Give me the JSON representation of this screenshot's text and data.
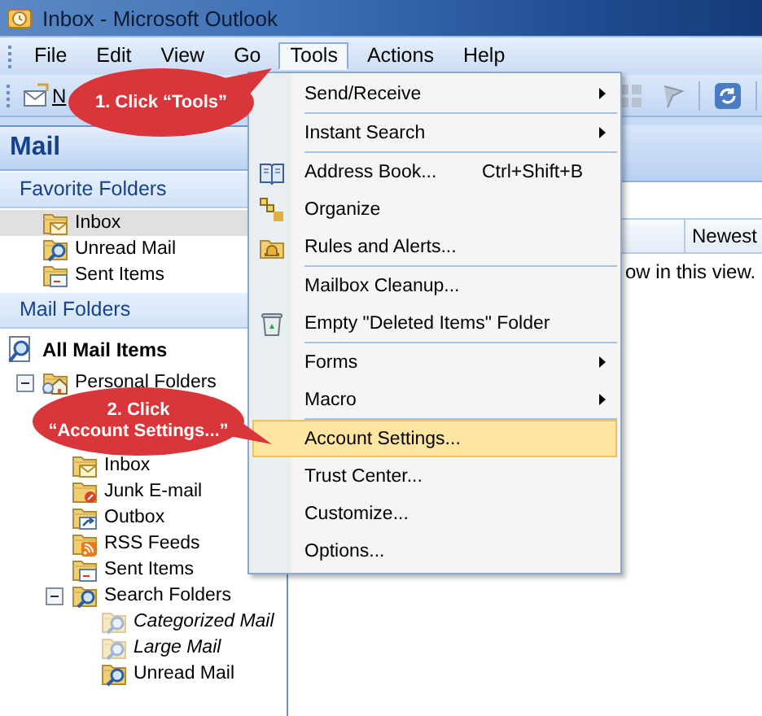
{
  "window": {
    "title": "Inbox - Microsoft Outlook"
  },
  "menu_bar": [
    {
      "label": "File",
      "selected": false
    },
    {
      "label": "Edit",
      "selected": false
    },
    {
      "label": "View",
      "selected": false
    },
    {
      "label": "Go",
      "selected": false
    },
    {
      "label": "Tools",
      "selected": true
    },
    {
      "label": "Actions",
      "selected": false
    },
    {
      "label": "Help",
      "selected": false
    }
  ],
  "toolbar": {
    "new_button": "N"
  },
  "navigation": {
    "title": "Mail",
    "favorites": {
      "title": "Favorite Folders",
      "items": [
        {
          "label": "Inbox",
          "kind": "inbox",
          "selected": true
        },
        {
          "label": "Unread Mail",
          "kind": "search",
          "selected": false
        },
        {
          "label": "Sent Items",
          "kind": "sent",
          "selected": false
        }
      ]
    },
    "mail_folders": {
      "title": "Mail Folders",
      "all_items": "All Mail Items",
      "tree": [
        {
          "label": "Personal Folders",
          "kind": "personal",
          "selected": false,
          "expanded": true,
          "children": [
            {
              "label": "Inbox",
              "kind": "inbox",
              "selected": false
            },
            {
              "label": "Junk E-mail",
              "kind": "junk",
              "selected": false
            },
            {
              "label": "Outbox",
              "kind": "outbox",
              "selected": false
            },
            {
              "label": "RSS Feeds",
              "kind": "rss",
              "selected": false
            },
            {
              "label": "Sent Items",
              "kind": "sent",
              "selected": false
            },
            {
              "label": "Search Folders",
              "kind": "search",
              "selected": false,
              "expanded": true,
              "children": [
                {
                  "label": "Categorized Mail",
                  "kind": "search",
                  "selected": false,
                  "dimmed": true
                },
                {
                  "label": "Large Mail",
                  "kind": "search",
                  "selected": false,
                  "dimmed": true
                },
                {
                  "label": "Unread Mail",
                  "kind": "search",
                  "selected": false,
                  "dimmed": false
                }
              ]
            }
          ]
        }
      ]
    }
  },
  "content": {
    "column_header": "Newest",
    "empty_message": "ow in this view."
  },
  "tools_menu": {
    "sections": [
      [
        {
          "label": "Send/Receive",
          "kind": "plain",
          "submenu": true,
          "selected": false
        }
      ],
      [
        {
          "label": "Instant Search",
          "kind": "plain",
          "submenu": true,
          "selected": false
        }
      ],
      [
        {
          "label": "Address Book...",
          "shortcut": "Ctrl+Shift+B",
          "kind": "book",
          "submenu": false,
          "selected": false
        },
        {
          "label": "Organize",
          "kind": "organize",
          "submenu": false,
          "selected": false
        },
        {
          "label": "Rules and Alerts...",
          "kind": "rules",
          "submenu": false,
          "selected": false
        }
      ],
      [
        {
          "label": "Mailbox Cleanup...",
          "kind": "plain",
          "submenu": false,
          "selected": false
        },
        {
          "label": "Empty \"Deleted Items\" Folder",
          "kind": "trash",
          "submenu": false,
          "selected": false
        }
      ],
      [
        {
          "label": "Forms",
          "kind": "plain",
          "submenu": true,
          "selected": false
        },
        {
          "label": "Macro",
          "kind": "plain",
          "submenu": true,
          "selected": false
        }
      ],
      [
        {
          "label": "Account Settings...",
          "kind": "plain",
          "submenu": false,
          "selected": true
        },
        {
          "label": "Trust Center...",
          "kind": "plain",
          "submenu": false,
          "selected": false
        },
        {
          "label": "Customize...",
          "kind": "plain",
          "submenu": false,
          "selected": false
        },
        {
          "label": "Options...",
          "kind": "plain",
          "submenu": false,
          "selected": false
        }
      ]
    ]
  },
  "callouts": [
    {
      "text": "1. Click “Tools”"
    },
    {
      "text": "2. Click\n“Account Settings...”"
    }
  ]
}
